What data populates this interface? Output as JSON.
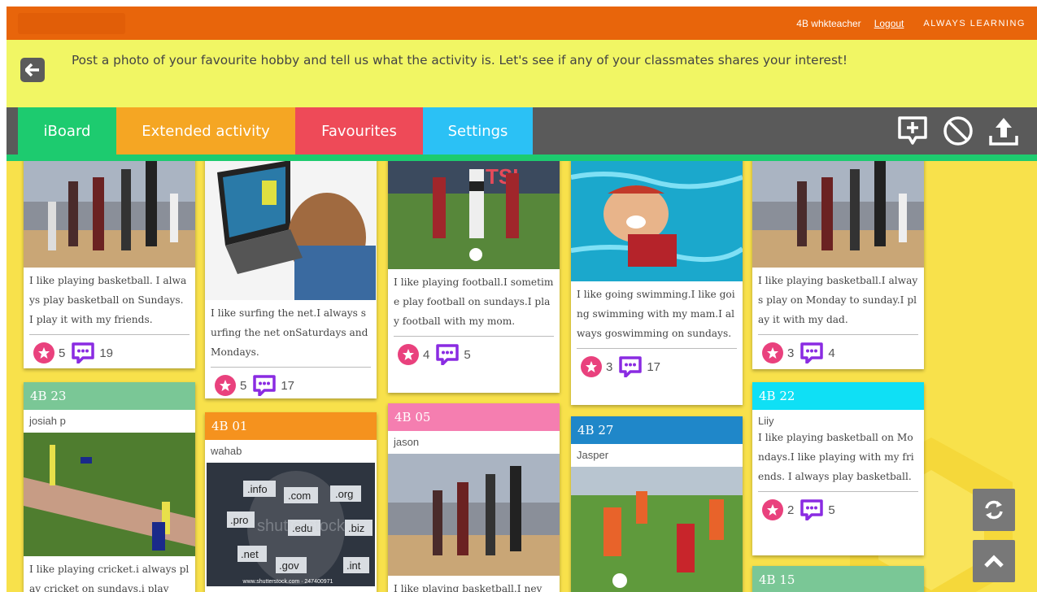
{
  "header": {
    "user": "4B  whkteacher",
    "logout": "Logout",
    "brand": "ALWAYS LEARNING"
  },
  "prompt": {
    "text": "Post a photo of your favourite hobby and tell us what the activity is. Let's see if any of your classmates shares your interest!"
  },
  "tabs": [
    {
      "label": "iBoard",
      "color": "#1dcb6f"
    },
    {
      "label": "Extended activity",
      "color": "#f5a623"
    },
    {
      "label": "Favourites",
      "color": "#ee4a58"
    },
    {
      "label": "Settings",
      "color": "#2bc1f5"
    }
  ],
  "toolbar_icons": [
    "add-post-icon",
    "block-icon",
    "upload-icon"
  ],
  "posts": [
    {
      "text": "I like playing basketball. I always play basketball on Sundays. I play it with my friends.",
      "likes": "5",
      "comments": "19",
      "image": "basketball"
    },
    {
      "text": "I like surfing the net.I always surfing the net onSaturdays and Mondays.",
      "likes": "5",
      "comments": "17",
      "image": "laptop"
    },
    {
      "text": "I like playing football.I sometime play football on sundays.I play football with my mom.",
      "likes": "4",
      "comments": "5",
      "image": "football"
    },
    {
      "text": "I like going swimming.I like going swimming with my mam.I always goswimming on sundays.",
      "likes": "3",
      "comments": "17",
      "image": "swimming-cat"
    },
    {
      "text": "I like playing basketball.I always play on Monday to sunday.I play it with my dad.",
      "likes": "3",
      "comments": "4",
      "image": "basketball"
    },
    {
      "header": "4B  23",
      "header_color": "#7ac796",
      "name": "josiah p",
      "text": "I like playing cricket.i always play cricket on sundays.i play",
      "image": "cricket"
    },
    {
      "header": "4B  01",
      "header_color": "#f5921e",
      "name": "wahab",
      "image": "domains",
      "domains": [
        ".info",
        ".com",
        ".org",
        ".pro",
        ".edu",
        ".biz",
        ".net",
        ".gov",
        ".int"
      ],
      "watermark": "shutterstock",
      "caption": "www.shutterstock.com · 247400971"
    },
    {
      "header": "4B  05",
      "header_color": "#f57eb0",
      "name": "jason",
      "text": "I like playing basketball.I nev",
      "image": "basketball"
    },
    {
      "header": "4B  27",
      "header_color": "#1f87c9",
      "name": "Jasper",
      "image": "kids-football"
    },
    {
      "header": "4B  22",
      "header_color": "#0fe0f5",
      "name": "Liiy",
      "text": "I like playing basketball on Mondays.I like playing with my friends. I always play basketball.",
      "likes": "2",
      "comments": "5"
    },
    {
      "header": "4B  15",
      "header_color": "#7ac796"
    }
  ],
  "colors": {
    "topbar": "#e8650b",
    "prompt_bg": "#f1f664",
    "board_bg": "#f8e14b",
    "star": "#e9417d",
    "comment": "#8a2be2"
  }
}
